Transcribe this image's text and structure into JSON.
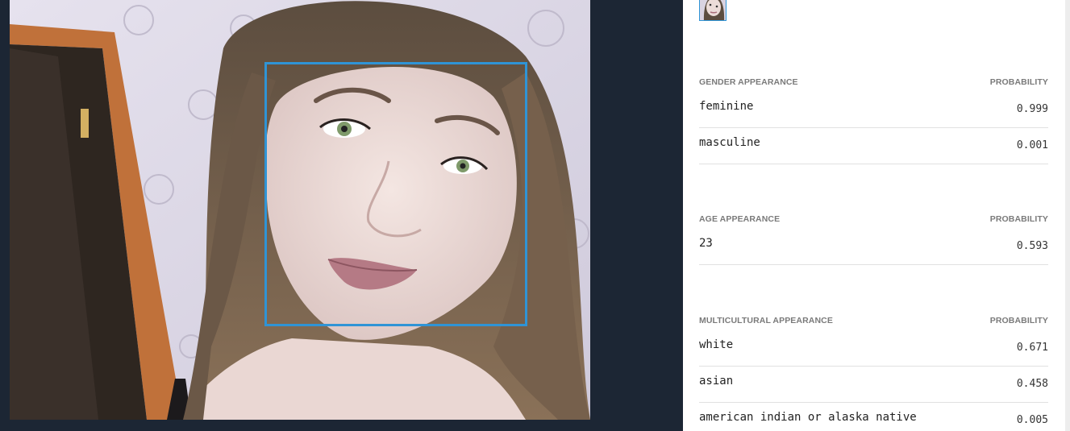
{
  "viewer": {
    "face_box_color": "#2f94d6"
  },
  "sections": [
    {
      "header": "GENDER APPEARANCE",
      "prob_header": "PROBABILITY",
      "rows": [
        {
          "label": "feminine",
          "value": "0.999"
        },
        {
          "label": "masculine",
          "value": "0.001"
        }
      ]
    },
    {
      "header": "AGE APPEARANCE",
      "prob_header": "PROBABILITY",
      "rows": [
        {
          "label": "23",
          "value": "0.593"
        }
      ]
    },
    {
      "header": "MULTICULTURAL APPEARANCE",
      "prob_header": "PROBABILITY",
      "rows": [
        {
          "label": "white",
          "value": "0.671"
        },
        {
          "label": "asian",
          "value": "0.458"
        },
        {
          "label": "american indian or alaska native",
          "value": "0.005"
        }
      ]
    }
  ]
}
